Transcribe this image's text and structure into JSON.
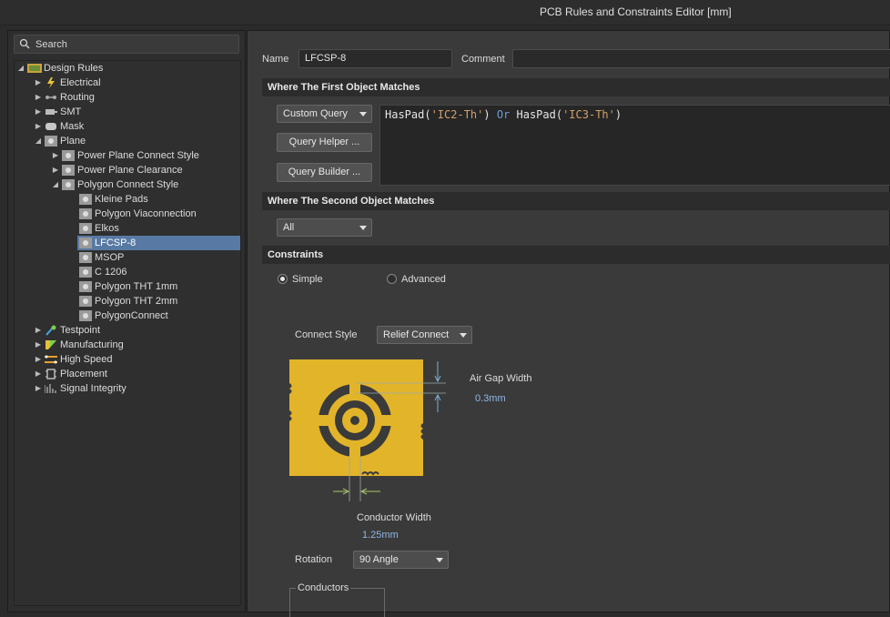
{
  "window": {
    "title": "PCB Rules and Constraints Editor [mm]"
  },
  "search": {
    "placeholder": "Search"
  },
  "tree": {
    "root": "Design Rules",
    "electrical": "Electrical",
    "routing": "Routing",
    "smt": "SMT",
    "mask": "Mask",
    "plane": "Plane",
    "power_plane_connect_style": "Power Plane Connect Style",
    "power_plane_clearance": "Power Plane Clearance",
    "polygon_connect_style": "Polygon Connect Style",
    "rules": [
      "Kleine Pads",
      "Polygon Viaconnection",
      "Elkos",
      "LFCSP-8",
      "MSOP",
      "C 1206",
      "Polygon THT 1mm",
      "Polygon THT 2mm",
      "PolygonConnect"
    ],
    "testpoint": "Testpoint",
    "manufacturing": "Manufacturing",
    "high_speed": "High Speed",
    "placement": "Placement",
    "signal_integrity": "Signal Integrity"
  },
  "form": {
    "name_label": "Name",
    "name_value": "LFCSP-8",
    "comment_label": "Comment",
    "comment_value": "",
    "first_match_title": "Where The First Object Matches",
    "first_match_dropdown": "Custom Query",
    "query_helper": "Query Helper ...",
    "query_builder": "Query Builder ...",
    "query": {
      "t1": "HasPad(",
      "s1": "'IC2-Th'",
      "t2": ") ",
      "kw": "Or",
      "t3": " HasPad(",
      "s2": "'IC3-Th'",
      "t4": ")"
    },
    "second_match_title": "Where The Second Object Matches",
    "second_match_dropdown": "All",
    "constraints_title": "Constraints",
    "simple": "Simple",
    "advanced": "Advanced",
    "connect_style_label": "Connect Style",
    "connect_style_value": "Relief Connect",
    "air_gap_label": "Air Gap Width",
    "air_gap_value": "0.3mm",
    "conductor_width_label": "Conductor Width",
    "conductor_width_value": "1.25mm",
    "rotation_label": "Rotation",
    "rotation_value": "90 Angle",
    "conductors_label": "Conductors"
  },
  "colors": {
    "selection": "#5879a3",
    "copper": "#e2b42a",
    "accent_value": "#8fb7e3"
  }
}
